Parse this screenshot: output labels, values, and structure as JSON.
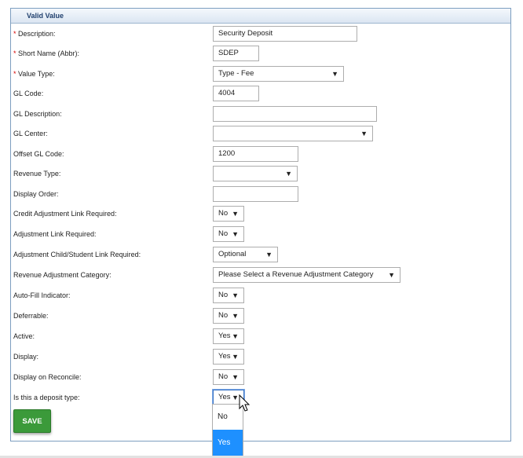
{
  "panel": {
    "title": "Valid Value"
  },
  "fields": {
    "description": {
      "label": "Description:",
      "value": "Security Deposit"
    },
    "short_name": {
      "label": "Short Name (Abbr):",
      "value": "SDEP"
    },
    "value_type": {
      "label": "Value Type:",
      "value": "Type - Fee"
    },
    "gl_code": {
      "label": "GL Code:",
      "value": "4004"
    },
    "gl_description": {
      "label": "GL Description:",
      "value": ""
    },
    "gl_center": {
      "label": "GL Center:",
      "value": ""
    },
    "offset_gl_code": {
      "label": "Offset GL Code:",
      "value": "1200"
    },
    "revenue_type": {
      "label": "Revenue Type:",
      "value": ""
    },
    "display_order": {
      "label": "Display Order:",
      "value": ""
    },
    "credit_adj_link": {
      "label": "Credit Adjustment Link Required:",
      "value": "No"
    },
    "adj_link": {
      "label": "Adjustment Link Required:",
      "value": "No"
    },
    "adj_child_link": {
      "label": "Adjustment Child/Student Link Required:",
      "value": "Optional"
    },
    "revenue_adj_category": {
      "label": "Revenue Adjustment Category:",
      "value": "Please Select a Revenue Adjustment Category"
    },
    "auto_fill": {
      "label": "Auto-Fill Indicator:",
      "value": "No"
    },
    "deferrable": {
      "label": "Deferrable:",
      "value": "No"
    },
    "active": {
      "label": "Active:",
      "value": "Yes"
    },
    "display": {
      "label": "Display:",
      "value": "Yes"
    },
    "display_on_reconcile": {
      "label": "Display on Reconcile:",
      "value": "No"
    },
    "deposit_type": {
      "label": "Is this a deposit type:",
      "value": "Yes"
    }
  },
  "required_marker": "*",
  "save_label": "SAVE",
  "dropdown": {
    "options": [
      "No",
      "Yes"
    ],
    "selected": "Yes"
  },
  "colors": {
    "accent": "#1e90ff",
    "save": "#3b9a3a",
    "required": "#d40000",
    "header_text": "#1f3f6d"
  },
  "icons": {
    "select_arrow": "▼",
    "cursor": "mouse-pointer"
  }
}
